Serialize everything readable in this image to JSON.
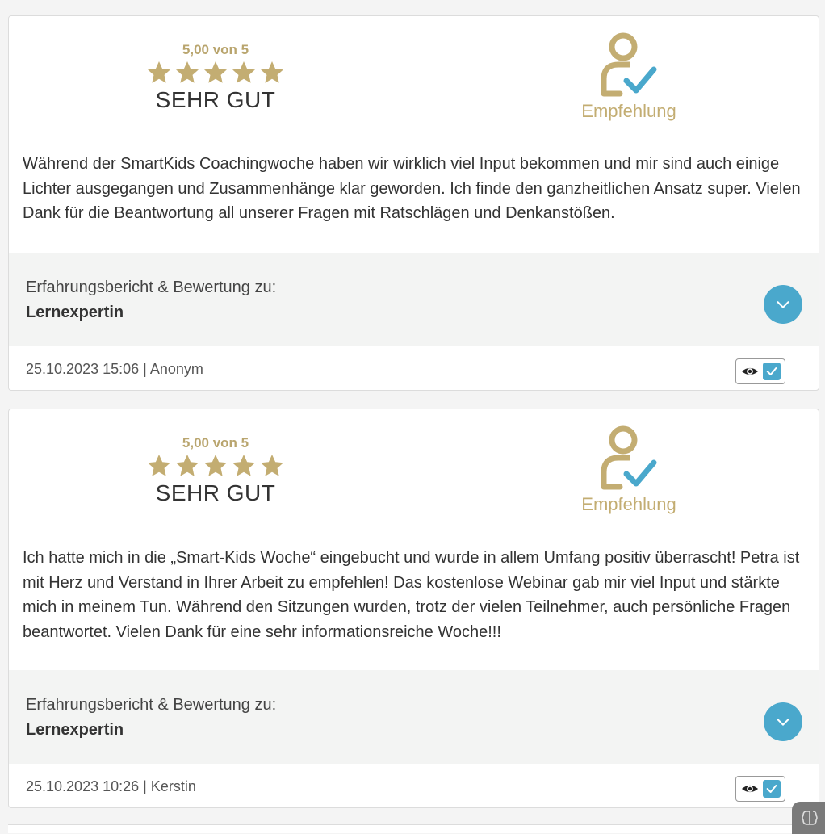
{
  "reviews": [
    {
      "score_text": "5,00 von 5",
      "stars": 5,
      "verdict": "SEHR GUT",
      "recommendation_label": "Empfehlung",
      "text": "Während der SmartKids Coachingwoche haben wir wirklich viel Input bekommen und mir sind auch einige Lichter ausgegangen und Zusammenhänge klar geworden. Ich finde den ganzheitlichen Ansatz super. Vielen Dank für die Beantwortung all unserer Fragen mit Ratschlägen und Denkanstößen.",
      "about_label": "Erfahrungsbericht & Bewertung zu:",
      "product": "Lernexpertin",
      "meta": "25.10.2023 15:06 | Anonym"
    },
    {
      "score_text": "5,00 von 5",
      "stars": 5,
      "verdict": "SEHR GUT",
      "recommendation_label": "Empfehlung",
      "text": "Ich hatte mich in die „Smart-Kids Woche“ eingebucht und wurde in allem Umfang positiv überrascht! Petra ist mit Herz und Verstand in Ihrer Arbeit zu empfehlen! Das kostenlose Webinar gab mir viel Input und stärkte mich in meinem Tun. Während den Sitzungen wurden, trotz der vielen Teilnehmer, auch persönliche Fragen beantwortet. Vielen Dank für eine sehr informationsreiche Woche!!!",
      "about_label": "Erfahrungsbericht & Bewertung zu:",
      "product": "Lernexpertin",
      "meta": "25.10.2023 10:26 | Kerstin"
    }
  ],
  "icons": {
    "star": "star-icon",
    "recommend": "person-check-icon",
    "expand": "chevron-down-icon",
    "eye": "eye-icon",
    "verified": "checkmark-icon"
  },
  "colors": {
    "gold": "#c3ad72",
    "accent_blue": "#4aa8cc",
    "band_gray": "#f3f4f3"
  }
}
